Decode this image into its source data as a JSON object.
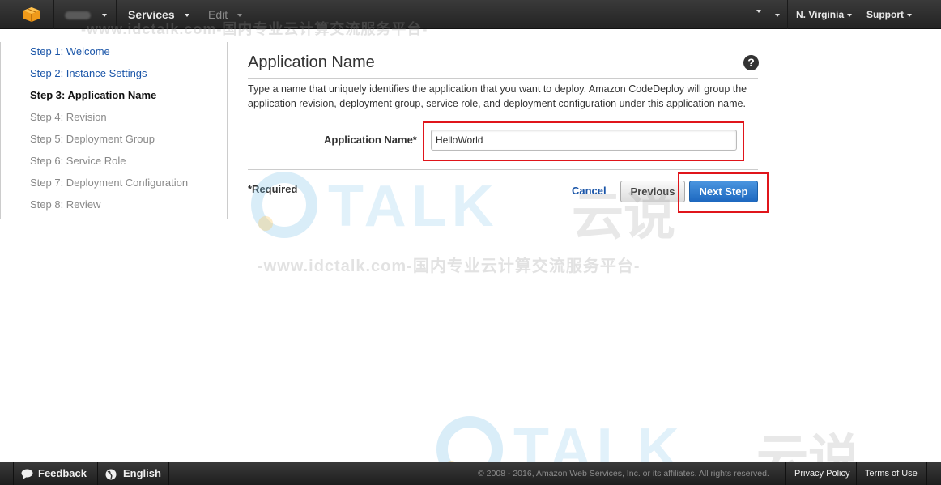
{
  "topbar": {
    "services": "Services",
    "edit": "Edit",
    "region": "N. Virginia",
    "support": "Support"
  },
  "sidebar": {
    "steps": [
      {
        "label": "Step 1: Welcome",
        "state": "done"
      },
      {
        "label": "Step 2: Instance Settings",
        "state": "done"
      },
      {
        "label": "Step 3: Application Name",
        "state": "current"
      },
      {
        "label": "Step 4: Revision",
        "state": "future"
      },
      {
        "label": "Step 5: Deployment Group",
        "state": "future"
      },
      {
        "label": "Step 6: Service Role",
        "state": "future"
      },
      {
        "label": "Step 7: Deployment Configuration",
        "state": "future"
      },
      {
        "label": "Step 8: Review",
        "state": "future"
      }
    ]
  },
  "main": {
    "title": "Application Name",
    "help_glyph": "?",
    "description": "Type a name that uniquely identifies the application that you want to deploy. Amazon CodeDeploy will group the application revision, deployment group, service role, and deployment configuration under this application name.",
    "field_label": "Application Name*",
    "field_value": "HelloWorld",
    "required_note": "*Required",
    "cancel": "Cancel",
    "previous": "Previous",
    "next": "Next Step"
  },
  "watermark": {
    "url_text": "-www.idctalk.com-国内专业云计算交流服务平台-",
    "brand": "TALK",
    "brand_cn": "云说"
  },
  "footer": {
    "feedback": "Feedback",
    "language": "English",
    "copyright": "© 2008 - 2016, Amazon Web Services, Inc. or its affiliates. All rights reserved.",
    "privacy": "Privacy Policy",
    "terms": "Terms of Use"
  },
  "colors": {
    "highlight": "#e0151b",
    "link": "#1a55a8",
    "primary_button": "#1d68c0"
  }
}
